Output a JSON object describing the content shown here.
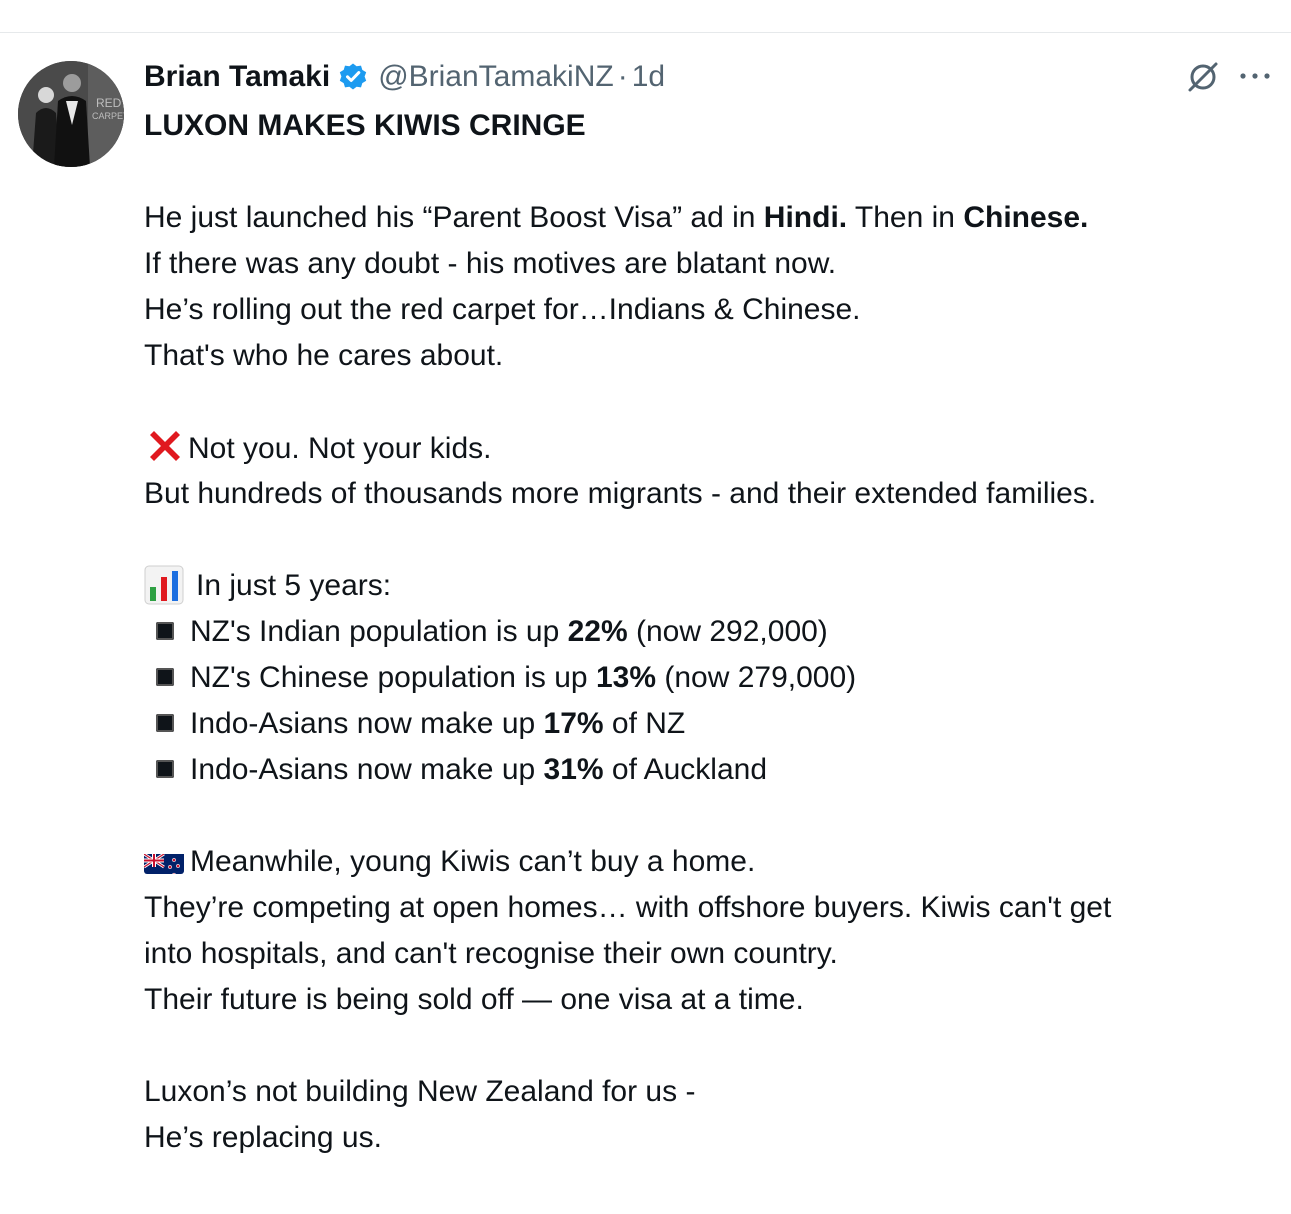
{
  "author": {
    "display_name": "Brian Tamaki",
    "handle": "@BrianTamakiNZ",
    "separator": "·",
    "time": "1d"
  },
  "avatar": {
    "backdrop_text_1": "RED",
    "backdrop_text_2": "CARPET"
  },
  "tweet": {
    "title": "LUXON MAKES KIWIS CRINGE",
    "p1": {
      "l1_a": "He just launched his “Parent Boost Visa” ad in ",
      "l1_b": "Hindi.",
      "l1_c": " Then in ",
      "l1_d": "Chinese.",
      "l2": "If there was any doubt - his motives are blatant now.",
      "l3": "He’s rolling out the red carpet for…Indians & Chinese.",
      "l4": "That's who he cares about."
    },
    "p2": {
      "l1": "Not you. Not your kids.",
      "l2": "But hundreds of thousands more migrants - and their extended families."
    },
    "p3": {
      "heading": "In just 5 years:",
      "bullets": [
        {
          "a": "NZ's Indian population is up ",
          "b": "22%",
          "c": " (now 292,000)"
        },
        {
          "a": "NZ's Chinese population is up ",
          "b": "13%",
          "c": " (now 279,000)"
        },
        {
          "a": "Indo-Asians now make up ",
          "b": "17%",
          "c": " of NZ"
        },
        {
          "a": "Indo-Asians now make up ",
          "b": "31%",
          "c": " of Auckland"
        }
      ]
    },
    "p4": {
      "l1": "Meanwhile, young Kiwis can’t buy a home.",
      "l2": "They’re competing at open homes… with offshore buyers. Kiwis can't get",
      "l3": "into hospitals, and can't recognise their own country.",
      "l4": "Their future is being sold off — one visa at a time."
    },
    "p5": {
      "l1": "Luxon’s not building New Zealand for us -",
      "l2": "He’s replacing us."
    }
  },
  "icons": {
    "verified": "verified-badge-icon",
    "grok": "grok-icon",
    "more": "more-options-icon",
    "cross_mark": "cross-mark-emoji-icon",
    "bar_chart": "bar-chart-emoji-icon",
    "bullet": "black-square-bullet-icon",
    "flag": "new-zealand-flag-emoji-icon"
  },
  "colors": {
    "verified_blue": "#1d9bf0",
    "secondary_text": "#536471",
    "primary_text": "#0f1419",
    "cross_red": "#e0191f"
  }
}
